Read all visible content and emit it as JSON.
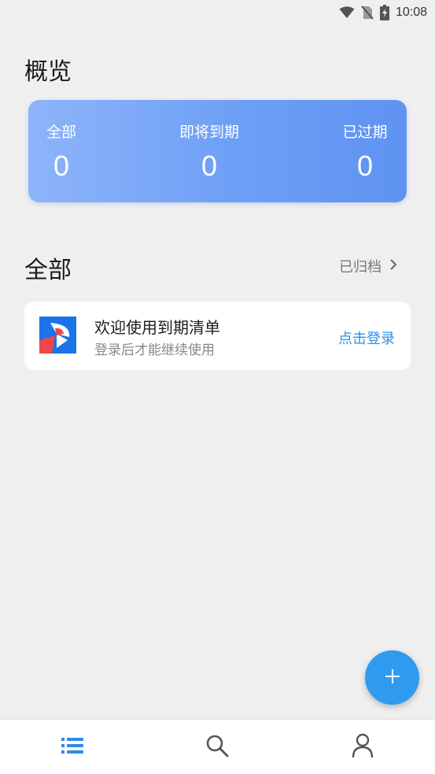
{
  "status_bar": {
    "time": "10:08",
    "icons": [
      "wifi-icon",
      "no-sim-icon",
      "battery-charging-icon"
    ]
  },
  "overview": {
    "title": "概览",
    "stats": [
      {
        "label": "全部",
        "value": "0"
      },
      {
        "label": "即将到期",
        "value": "0"
      },
      {
        "label": "已过期",
        "value": "0"
      }
    ],
    "gradient_colors": [
      "#8db4f9",
      "#5f93f2"
    ]
  },
  "list_section": {
    "title": "全部",
    "archive_label": "已归档",
    "archive_icon": "chevron-right-icon"
  },
  "welcome_card": {
    "title": "欢迎使用到期清单",
    "subtitle": "登录后才能继续使用",
    "action_label": "点击登录",
    "action_color": "#2a8fe8",
    "logo_icon": "app-logo-icon"
  },
  "fab": {
    "icon": "plus-icon",
    "color": "#2f9bf0"
  },
  "bottom_nav": {
    "items": [
      {
        "icon": "list-icon",
        "active": true,
        "color": "#2f8ae8"
      },
      {
        "icon": "search-icon",
        "active": false,
        "color": "#555555"
      },
      {
        "icon": "profile-icon",
        "active": false,
        "color": "#555555"
      }
    ]
  }
}
